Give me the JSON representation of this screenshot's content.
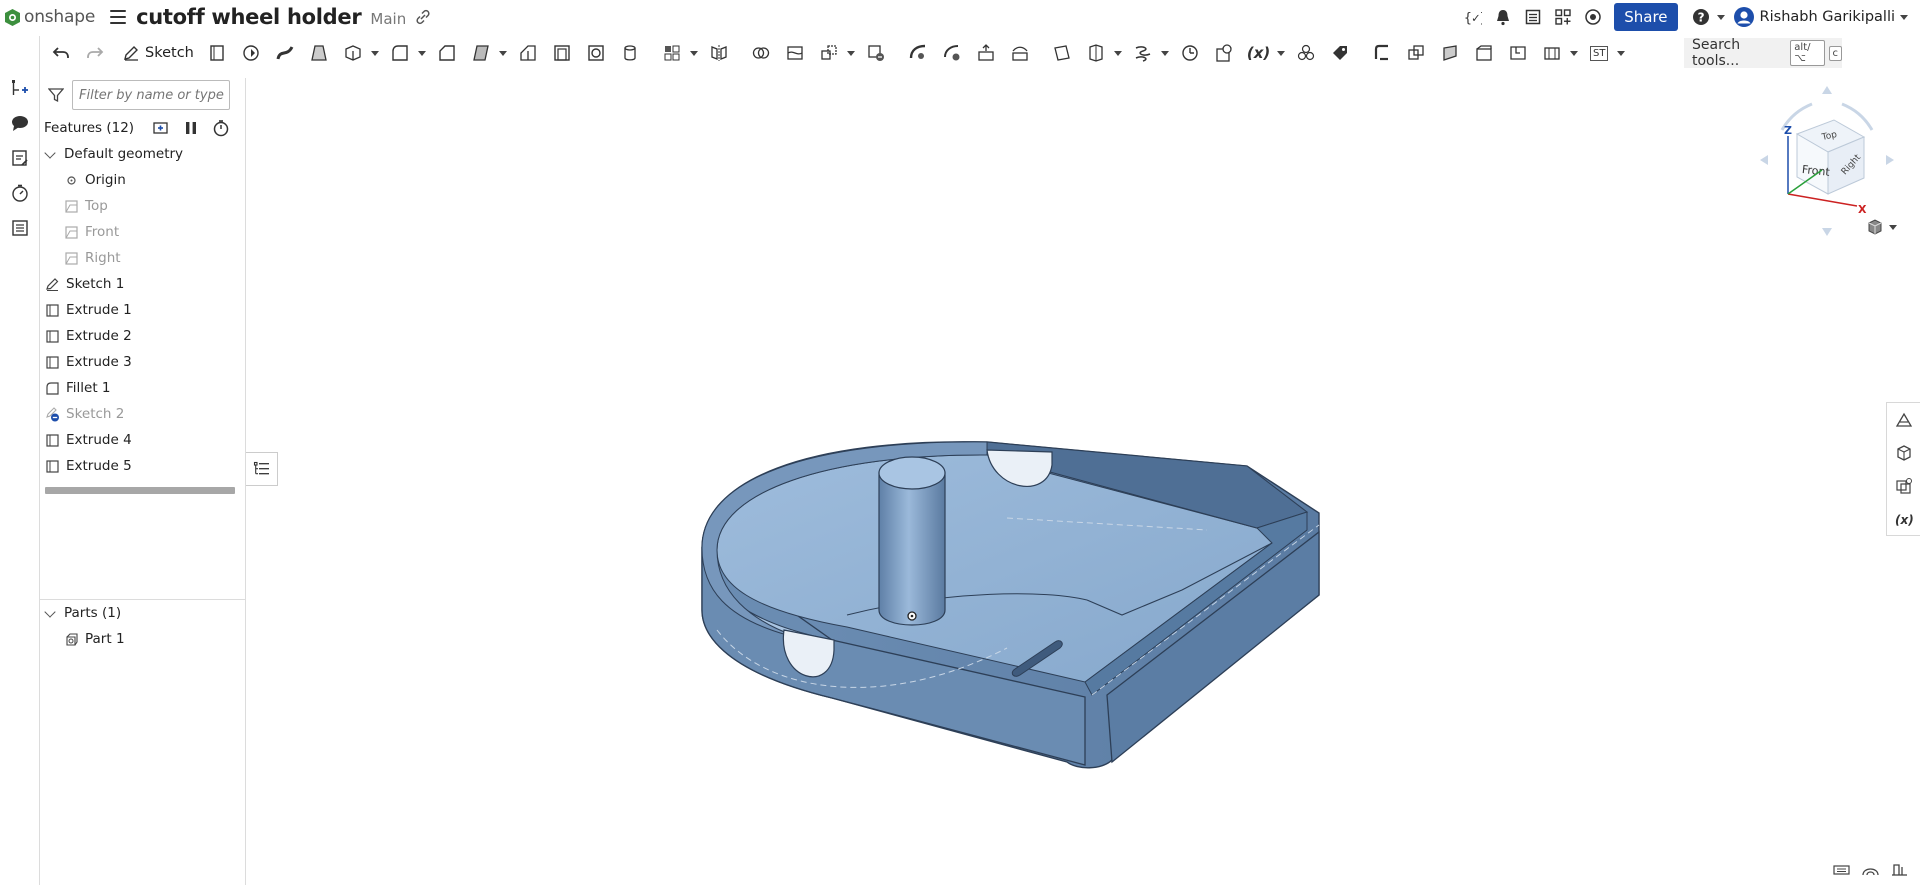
{
  "header": {
    "logo_text": "onshape",
    "document_title": "cutoff wheel holder",
    "branch": "Main",
    "share_label": "Share",
    "user_name": "Rishabh Garikipalli"
  },
  "toolbar": {
    "sketch_label": "Sketch",
    "search_label": "Search tools...",
    "search_shortcut_1": "alt/⌥",
    "search_shortcut_2": "c",
    "variable_label": "(x)",
    "st_label": "ST"
  },
  "feature_panel": {
    "filter_placeholder": "Filter by name or type",
    "features_header": "Features (12)",
    "default_geometry": "Default geometry",
    "origin": "Origin",
    "planes": [
      "Top",
      "Front",
      "Right"
    ],
    "features": [
      {
        "name": "Sketch 1",
        "type": "sketch"
      },
      {
        "name": "Extrude 1",
        "type": "extrude"
      },
      {
        "name": "Extrude 2",
        "type": "extrude"
      },
      {
        "name": "Extrude 3",
        "type": "extrude"
      },
      {
        "name": "Fillet 1",
        "type": "fillet"
      },
      {
        "name": "Sketch 2",
        "type": "sketch-hidden"
      },
      {
        "name": "Extrude 4",
        "type": "extrude"
      },
      {
        "name": "Extrude 5",
        "type": "extrude"
      }
    ],
    "parts_header": "Parts (1)",
    "parts": [
      "Part 1"
    ]
  },
  "viewcube": {
    "top": "Top",
    "front": "Front",
    "right": "Right",
    "axis_x": "X",
    "axis_z": "Z"
  },
  "colors": {
    "accent": "#1d4eab",
    "part_face": "#8fb0d2",
    "part_dark": "#5d7ea3",
    "part_edge": "#2d3f57"
  }
}
